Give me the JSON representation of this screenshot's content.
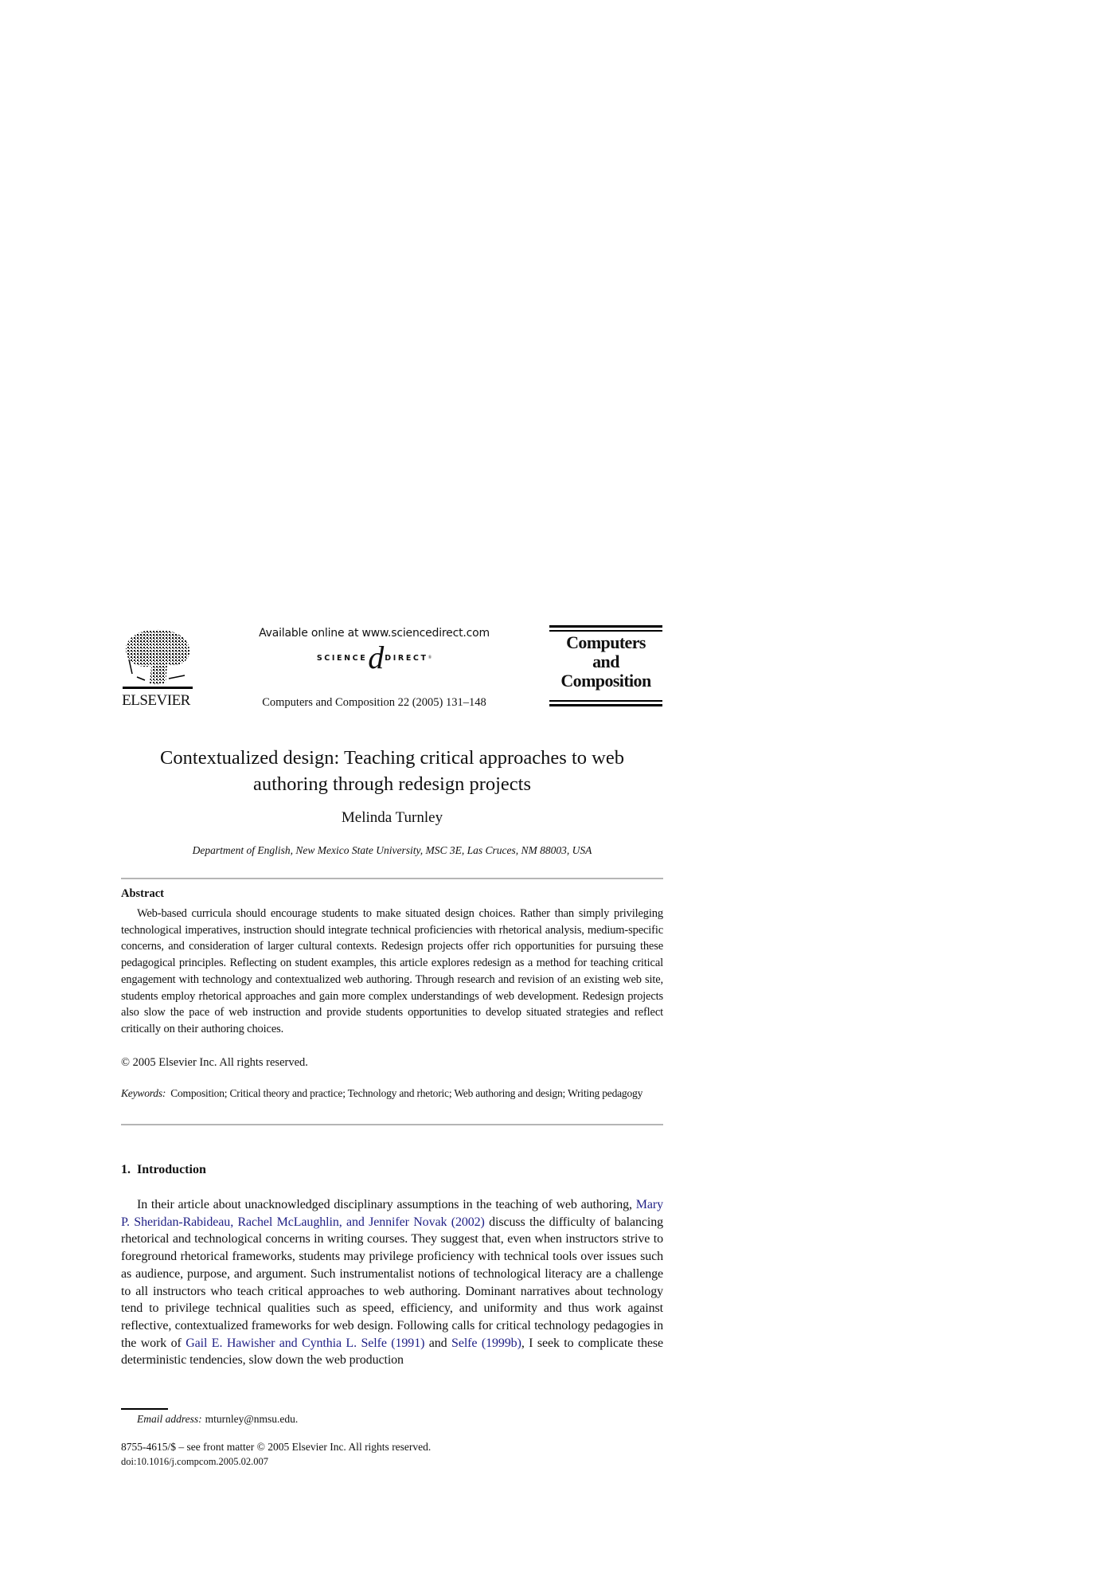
{
  "header": {
    "publisher_logo_text": "ELSEVIER",
    "available_online": "Available online at www.sciencedirect.com",
    "sciencedirect_logo": {
      "left": "SCIENCE",
      "at": "d",
      "right": "DIRECT",
      "reg": "®"
    },
    "journal_citation": "Computers and Composition 22 (2005) 131–148",
    "journal_logo_lines": [
      "Computers",
      "and",
      "Composition"
    ]
  },
  "article": {
    "title": "Contextualized design: Teaching critical approaches to web authoring through redesign projects",
    "author": "Melinda Turnley",
    "affiliation": "Department of English, New Mexico State University, MSC 3E, Las Cruces, NM 88003, USA"
  },
  "abstract": {
    "heading": "Abstract",
    "body": "Web-based curricula should encourage students to make situated design choices. Rather than simply privileging technological imperatives, instruction should integrate technical proficiencies with rhetorical analysis, medium-specific concerns, and consideration of larger cultural contexts. Redesign projects offer rich opportunities for pursuing these pedagogical principles. Reflecting on student examples, this article explores redesign as a method for teaching critical engagement with technology and contextualized web authoring. Through research and revision of an existing web site, students employ rhetorical approaches and gain more complex understandings of web development. Redesign projects also slow the pace of web instruction and provide students opportunities to develop situated strategies and reflect critically on their authoring choices.",
    "copyright": "© 2005 Elsevier Inc. All rights reserved."
  },
  "keywords": {
    "label": "Keywords:",
    "text": "Composition; Critical theory and practice; Technology and rhetoric; Web authoring and design; Writing pedagogy"
  },
  "section": {
    "number": "1.",
    "title": "Introduction",
    "paragraph": {
      "part1": "In their article about unacknowledged disciplinary assumptions in the teaching of web authoring, ",
      "cite1": "Mary P. Sheridan-Rabideau, Rachel McLaughlin, and Jennifer Novak (2002)",
      "part2": " discuss the difficulty of balancing rhetorical and technological concerns in writing courses. They suggest that, even when instructors strive to foreground rhetorical frameworks, students may privilege proficiency with technical tools over issues such as audience, purpose, and argument. Such instrumentalist notions of technological literacy are a challenge to all instructors who teach critical approaches to web authoring. Dominant narratives about technology tend to privilege technical qualities such as speed, efficiency, and uniformity and thus work against reflective, contextualized frameworks for web design. Following calls for critical technology pedagogies in the work of ",
      "cite2": "Gail E. Hawisher and Cynthia L. Selfe (1991)",
      "part3": " and ",
      "cite3": "Selfe (1999b)",
      "part4": ", I seek to complicate these deterministic tendencies, slow down the web production"
    }
  },
  "footnote": {
    "email_label": "Email address:",
    "email": "mturnley@nmsu.edu."
  },
  "footer": {
    "front_matter": "8755-4615/$ – see front matter © 2005 Elsevier Inc. All rights reserved.",
    "doi": "doi:10.1016/j.compcom.2005.02.007"
  },
  "colors": {
    "citation_link": "#1f1f85",
    "rule": "#b5b5b5"
  }
}
